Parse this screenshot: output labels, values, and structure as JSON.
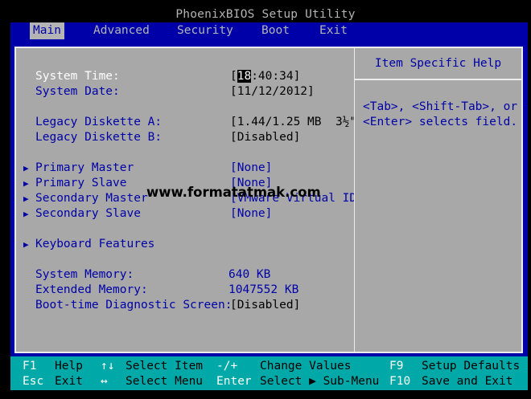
{
  "title": "PhoenixBIOS Setup Utility",
  "menu": [
    {
      "label": "Main",
      "active": true
    },
    {
      "label": "Advanced"
    },
    {
      "label": "Security"
    },
    {
      "label": "Boot"
    },
    {
      "label": "Exit"
    }
  ],
  "settings": {
    "system_time": {
      "label": "System Time:",
      "open": "[",
      "cursor": "18",
      "rest": ":40:34]"
    },
    "system_date": {
      "label": "System Date:",
      "value": "[11/12/2012]"
    },
    "legacy_a": {
      "label": "Legacy Diskette A:",
      "value": "[1.44/1.25 MB  3½\"]"
    },
    "legacy_b": {
      "label": "Legacy Diskette B:",
      "value": "[Disabled]"
    },
    "primary_master": {
      "label": "Primary Master",
      "value": "[None]"
    },
    "primary_slave": {
      "label": "Primary Slave",
      "value": "[None]"
    },
    "secondary_master": {
      "label": "Secondary Master",
      "value": "[VMware Virtual ID]"
    },
    "secondary_slave": {
      "label": "Secondary Slave",
      "value": "[None]"
    },
    "keyboard_features": {
      "label": "Keyboard Features"
    },
    "system_memory": {
      "label": "System Memory:",
      "value": "640 KB"
    },
    "extended_memory": {
      "label": "Extended Memory:",
      "value": "1047552 KB"
    },
    "boot_diag": {
      "label": "Boot-time Diagnostic Screen:",
      "value": "[Disabled]"
    }
  },
  "submenu_arrow": "▶",
  "watermark": "www.formatatmak.com",
  "help": {
    "title": "Item Specific Help",
    "line1": "<Tab>, <Shift-Tab>, or",
    "line2": "<Enter> selects field."
  },
  "footer": {
    "f1_key": "F1",
    "f1_desc": "Help",
    "updown_key": "↑↓",
    "updown_desc": "Select Item",
    "minusplus_key": "-/+",
    "minusplus_desc": "Change Values",
    "f9_key": "F9",
    "f9_desc": "Setup Defaults",
    "esc_key": "Esc",
    "esc_desc": "Exit",
    "leftright_key": "↔",
    "leftright_desc": "Select Menu",
    "enter_key": "Enter",
    "enter_desc": "Select ▶ Sub-Menu",
    "f10_key": "F10",
    "f10_desc": "Save and Exit"
  },
  "colors": {
    "background": "#000000",
    "bios_blue": "#0000a8",
    "panel_gray": "#a8a8a8",
    "footer_cyan": "#00a8a8",
    "highlight_white": "#ffffff"
  }
}
